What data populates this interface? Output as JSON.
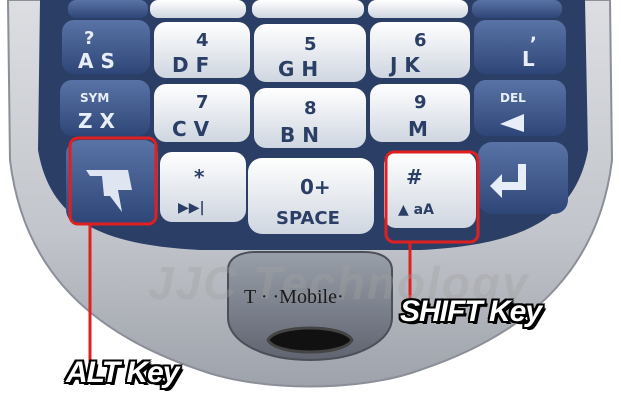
{
  "image": {
    "brand_text": "T · ·Mobile·",
    "watermark_text": "JJC Technology",
    "callouts": {
      "alt": "ALT Key",
      "shift": "SHIFT Key"
    },
    "keys": {
      "row1": [
        "? A S",
        "4 D F",
        "5 G H",
        "6 J K",
        ", L"
      ],
      "row2": [
        "SYM Z X",
        "7 C V",
        "8 B N",
        "9 M",
        "DEL"
      ],
      "row3": [
        "*",
        "0+ SPACE",
        "# aA"
      ]
    },
    "colors": {
      "highlight": "#e02020",
      "key_dark": "#3c5585",
      "key_light": "#e9edf2",
      "body": "#c9ccd2"
    }
  }
}
